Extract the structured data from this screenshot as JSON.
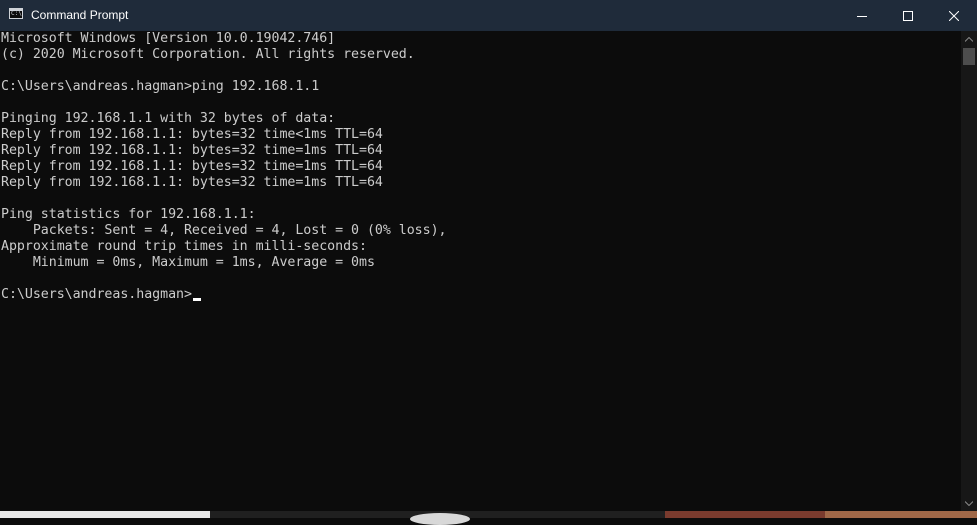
{
  "window": {
    "title": "Command Prompt",
    "app_icon_glyph": "C:\\"
  },
  "controls": {
    "minimize": "minimize-icon",
    "maximize": "maximize-icon",
    "close": "close-icon"
  },
  "console": {
    "lines": [
      "Microsoft Windows [Version 10.0.19042.746]",
      "(c) 2020 Microsoft Corporation. All rights reserved.",
      "",
      "C:\\Users\\andreas.hagman>ping 192.168.1.1",
      "",
      "Pinging 192.168.1.1 with 32 bytes of data:",
      "Reply from 192.168.1.1: bytes=32 time<1ms TTL=64",
      "Reply from 192.168.1.1: bytes=32 time=1ms TTL=64",
      "Reply from 192.168.1.1: bytes=32 time=1ms TTL=64",
      "Reply from 192.168.1.1: bytes=32 time=1ms TTL=64",
      "",
      "Ping statistics for 192.168.1.1:",
      "    Packets: Sent = 4, Received = 4, Lost = 0 (0% loss),",
      "Approximate round trip times in milli-seconds:",
      "    Minimum = 0ms, Maximum = 1ms, Average = 0ms",
      "",
      "C:\\Users\\andreas.hagman>"
    ]
  },
  "colors": {
    "titlebar": "#1f2b3a",
    "console_bg": "#0c0c0c",
    "console_text": "#cccccc"
  }
}
